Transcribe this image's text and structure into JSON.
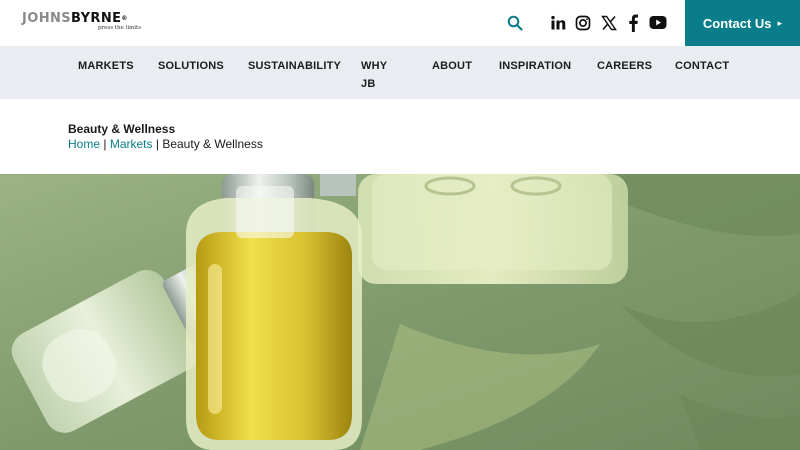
{
  "header": {
    "logo_part1": "JOHNS",
    "logo_part2": "BYRNE",
    "logo_reg": "®",
    "logo_tagline": "press the limits",
    "contact_label": "Contact Us",
    "contact_arrow": "▸",
    "icons": [
      "search-icon",
      "linkedin-icon",
      "instagram-icon",
      "x-icon",
      "facebook-icon",
      "youtube-icon"
    ],
    "accent_color": "#097d8a"
  },
  "nav": {
    "items": [
      {
        "label": "MARKETS"
      },
      {
        "label": "SOLUTIONS"
      },
      {
        "label": "SUSTAINABILITY"
      },
      {
        "label": "WHY JB"
      },
      {
        "label": "ABOUT"
      },
      {
        "label": "INSPIRATION"
      },
      {
        "label": "CAREERS"
      },
      {
        "label": "CONTACT"
      }
    ]
  },
  "page": {
    "title": "Beauty & Wellness",
    "breadcrumb": {
      "home": "Home",
      "markets": "Markets",
      "current": "Beauty & Wellness",
      "separator": "|"
    }
  },
  "hero": {
    "image": "perfume-bottles-on-green-background"
  }
}
